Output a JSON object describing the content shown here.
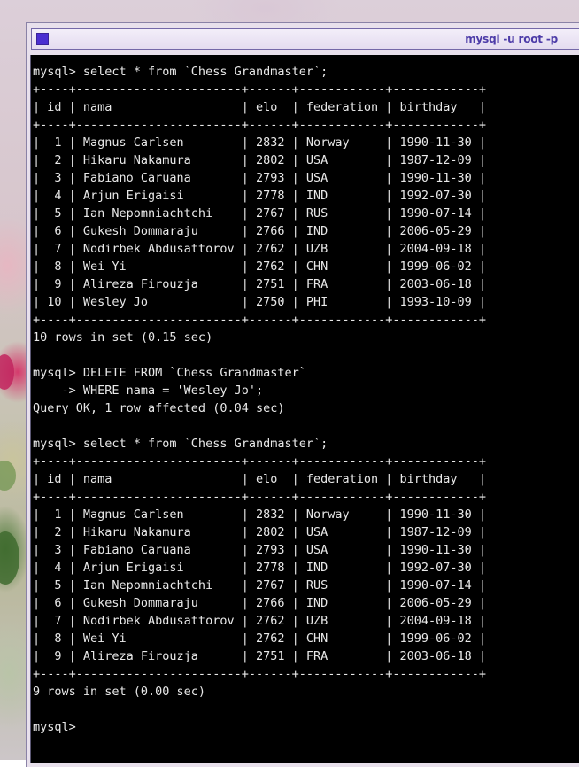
{
  "window": {
    "title": "mysql -u root -p"
  },
  "terminal": {
    "lines": [
      "mysql> select * from `Chess Grandmaster`;",
      "+----+-----------------------+------+------------+------------+",
      "| id | nama                  | elo  | federation | birthday   |",
      "+----+-----------------------+------+------------+------------+",
      "|  1 | Magnus Carlsen        | 2832 | Norway     | 1990-11-30 |",
      "|  2 | Hikaru Nakamura       | 2802 | USA        | 1987-12-09 |",
      "|  3 | Fabiano Caruana       | 2793 | USA        | 1990-11-30 |",
      "|  4 | Arjun Erigaisi        | 2778 | IND        | 1992-07-30 |",
      "|  5 | Ian Nepomniachtchi    | 2767 | RUS        | 1990-07-14 |",
      "|  6 | Gukesh Dommaraju      | 2766 | IND        | 2006-05-29 |",
      "|  7 | Nodirbek Abdusattorov | 2762 | UZB        | 2004-09-18 |",
      "|  8 | Wei Yi                | 2762 | CHN        | 1999-06-02 |",
      "|  9 | Alireza Firouzja      | 2751 | FRA        | 2003-06-18 |",
      "| 10 | Wesley Jo             | 2750 | PHI        | 1993-10-09 |",
      "+----+-----------------------+------+------------+------------+",
      "10 rows in set (0.15 sec)",
      "",
      "mysql> DELETE FROM `Chess Grandmaster`",
      "    -> WHERE nama = 'Wesley Jo';",
      "Query OK, 1 row affected (0.04 sec)",
      "",
      "mysql> select * from `Chess Grandmaster`;",
      "+----+-----------------------+------+------------+------------+",
      "| id | nama                  | elo  | federation | birthday   |",
      "+----+-----------------------+------+------------+------------+",
      "|  1 | Magnus Carlsen        | 2832 | Norway     | 1990-11-30 |",
      "|  2 | Hikaru Nakamura       | 2802 | USA        | 1987-12-09 |",
      "|  3 | Fabiano Caruana       | 2793 | USA        | 1990-11-30 |",
      "|  4 | Arjun Erigaisi        | 2778 | IND        | 1992-07-30 |",
      "|  5 | Ian Nepomniachtchi    | 2767 | RUS        | 1990-07-14 |",
      "|  6 | Gukesh Dommaraju      | 2766 | IND        | 2006-05-29 |",
      "|  7 | Nodirbek Abdusattorov | 2762 | UZB        | 2004-09-18 |",
      "|  8 | Wei Yi                | 2762 | CHN        | 1999-06-02 |",
      "|  9 | Alireza Firouzja      | 2751 | FRA        | 2003-06-18 |",
      "+----+-----------------------+------+------------+------------+",
      "9 rows in set (0.00 sec)",
      "",
      "mysql> "
    ]
  },
  "colors": {
    "terminal_bg": "#000000",
    "terminal_fg": "#e8e8e8",
    "title_text": "#4d3ca8",
    "title_icon": "#4b2fd1"
  }
}
